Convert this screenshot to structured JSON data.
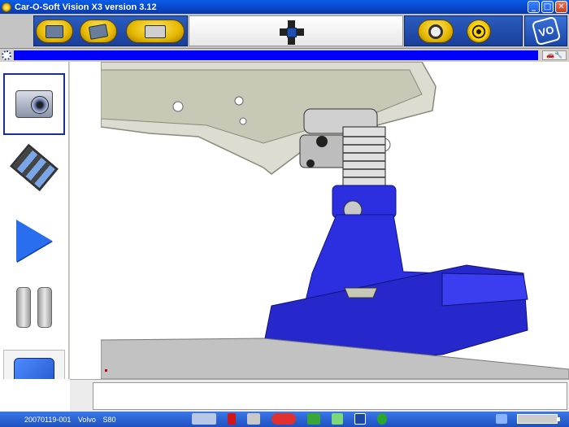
{
  "window": {
    "title": "Car-O-Soft Vision X3 version 3.12",
    "minimize_label": "_",
    "maximize_label": "□",
    "close_label": "✕"
  },
  "toolbar": {
    "buttons": [
      "document-tools-icon",
      "measurement-icon",
      "printer-icon"
    ],
    "right_buttons": [
      "zoom-search-icon",
      "target-icon"
    ],
    "logo_text": "VO"
  },
  "strip": {
    "mini_label": "🚗🔧"
  },
  "left_panel": {
    "items": [
      "camera-icon",
      "film-icon",
      "play-icon",
      "pause-icon",
      "stop-icon"
    ]
  },
  "statusbar": {
    "job_id": "20070119-001",
    "make": "Volvo",
    "model": "S80"
  },
  "colors": {
    "part_blue": "#2b2fe0",
    "chassis_beige": "#dcdcd0",
    "title_blue": "#0a5ee8",
    "strip_blue": "#0000ff"
  }
}
